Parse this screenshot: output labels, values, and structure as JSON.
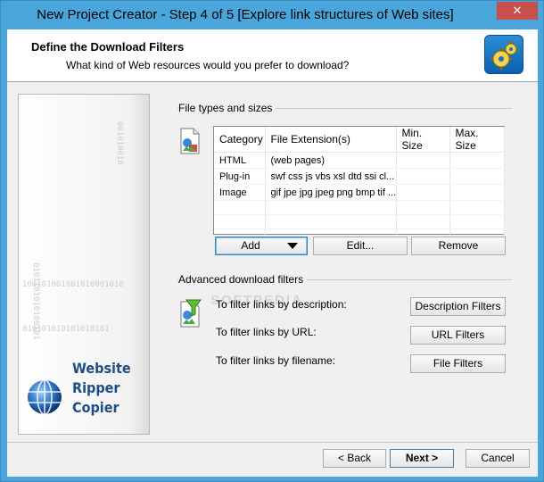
{
  "window": {
    "title": "New Project Creator - Step 4 of 5 [Explore link structures of Web sites]",
    "close_glyph": "✕"
  },
  "header": {
    "title": "Define the Download Filters",
    "subtitle": "What kind of Web resources would you prefer to download?"
  },
  "sidebar": {
    "binary_lines": [
      "100101001001010001010",
      "010101010101010101",
      "0101101010100101",
      "001010010"
    ],
    "brand": [
      "Website",
      "Ripper",
      "Copier"
    ]
  },
  "file_types": {
    "group_label": "File types and sizes",
    "columns": [
      "Category",
      "File Extension(s)",
      "Min. Size",
      "Max. Size"
    ],
    "rows": [
      {
        "category": "HTML",
        "extensions": "(web pages)",
        "min": "",
        "max": ""
      },
      {
        "category": "Plug-in",
        "extensions": "swf css js vbs xsl dtd ssi cl...",
        "min": "",
        "max": ""
      },
      {
        "category": "Image",
        "extensions": "gif jpe jpg jpeg png bmp tif ...",
        "min": "",
        "max": ""
      }
    ],
    "buttons": {
      "add": "Add",
      "edit": "Edit...",
      "remove": "Remove"
    }
  },
  "advanced": {
    "group_label": "Advanced download  filters",
    "watermark": "SOFTPEDIA",
    "rows": [
      {
        "label": "To filter links by description:",
        "button": "Description Filters"
      },
      {
        "label": "To filter links by URL:",
        "button": "URL Filters"
      },
      {
        "label": "To filter links by filename:",
        "button": "File Filters"
      }
    ]
  },
  "footer": {
    "back": "< Back",
    "next": "Next >",
    "cancel": "Cancel"
  }
}
